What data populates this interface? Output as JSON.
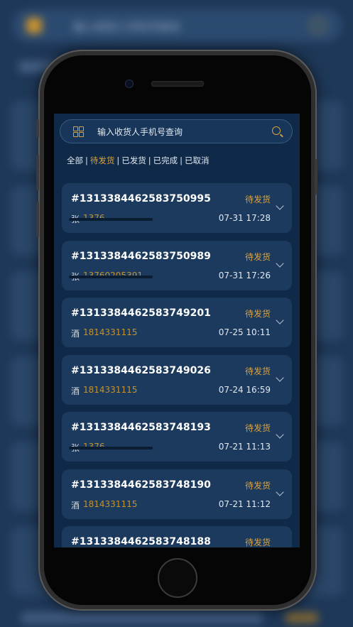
{
  "search": {
    "placeholder": "输入收货人手机号查询"
  },
  "filter": {
    "all": "全部",
    "pending": "待发货",
    "shipped": "已发货",
    "completed": "已完成",
    "cancelled": "已取消",
    "sep": "|"
  },
  "orders": [
    {
      "no": "#1313384462583750995",
      "status": "待发货",
      "name": "张",
      "phone": "1376",
      "time": "07-31 17:28"
    },
    {
      "no": "#1313384462583750989",
      "status": "待发货",
      "name": "张",
      "phone": "13760205391",
      "time": "07-31 17:26"
    },
    {
      "no": "#1313384462583749201",
      "status": "待发货",
      "name": "酒",
      "phone": "1814331115",
      "time": "07-25 10:11"
    },
    {
      "no": "#1313384462583749026",
      "status": "待发货",
      "name": "酒",
      "phone": "1814331115",
      "time": "07-24 16:59"
    },
    {
      "no": "#1313384462583748193",
      "status": "待发货",
      "name": "张",
      "phone": "1376",
      "time": "07-21 11:13"
    },
    {
      "no": "#1313384462583748190",
      "status": "待发货",
      "name": "酒",
      "phone": "1814331115",
      "time": "07-21 11:12"
    },
    {
      "no": "#1313384462583748188",
      "status": "待发货",
      "name": "",
      "phone": "",
      "time": ""
    }
  ],
  "colors": {
    "accent": "#d9a243",
    "screen_bg": "#0f2a48",
    "card_bg": "#1b3a5e"
  },
  "icons": {
    "menu": "grid-icon",
    "search": "search-icon",
    "expand": "chevron-down-icon"
  }
}
